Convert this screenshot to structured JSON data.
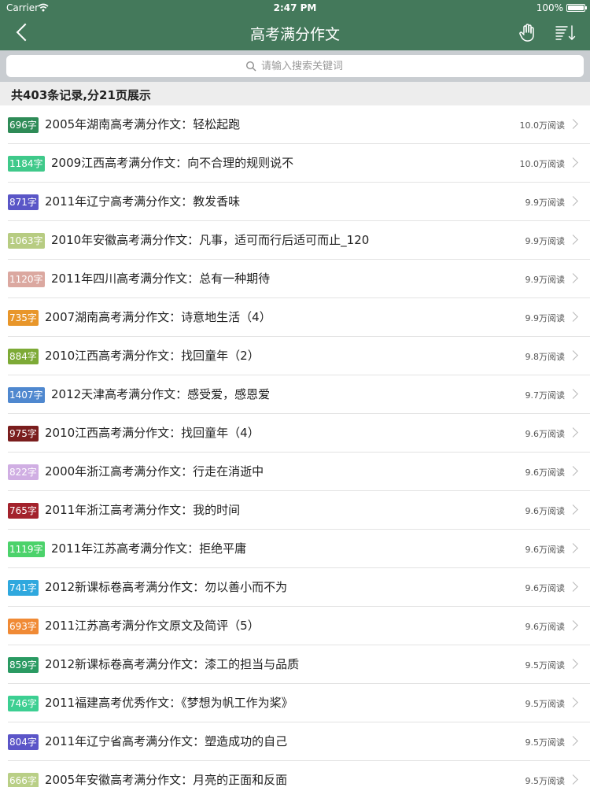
{
  "status": {
    "carrier": "Carrier",
    "time": "2:47 PM",
    "battery": "100%"
  },
  "nav": {
    "title": "高考满分作文"
  },
  "search": {
    "placeholder": "请输入搜索关键词"
  },
  "summary": "共403条记录,分21页展示",
  "items": [
    {
      "badge": "696字",
      "color": "#2e8b57",
      "title": "2005年湖南高考满分作文：轻松起跑",
      "reads": "10.0万阅读"
    },
    {
      "badge": "1184字",
      "color": "#3fc98a",
      "title": "2009江西高考满分作文：向不合理的规则说不",
      "reads": "10.0万阅读"
    },
    {
      "badge": "871字",
      "color": "#5a56c7",
      "title": "2011年辽宁高考满分作文：教发香味",
      "reads": "9.9万阅读"
    },
    {
      "badge": "1063字",
      "color": "#b7cc82",
      "title": "2010年安徽高考满分作文：凡事，适可而行后适可而止_120",
      "reads": "9.9万阅读"
    },
    {
      "badge": "1120字",
      "color": "#dba8a0",
      "title": "2011年四川高考满分作文：总有一种期待",
      "reads": "9.9万阅读"
    },
    {
      "badge": "735字",
      "color": "#e8962a",
      "title": "2007湖南高考满分作文：诗意地生活（4）",
      "reads": "9.9万阅读"
    },
    {
      "badge": "884字",
      "color": "#7daa36",
      "title": "2010江西高考满分作文：找回童年（2）",
      "reads": "9.8万阅读"
    },
    {
      "badge": "1407字",
      "color": "#4f88cf",
      "title": "2012天津高考满分作文：感受爱，感恩爱",
      "reads": "9.7万阅读"
    },
    {
      "badge": "975字",
      "color": "#7a1d1d",
      "title": "2010江西高考满分作文：找回童年（4）",
      "reads": "9.6万阅读"
    },
    {
      "badge": "822字",
      "color": "#d0aee3",
      "title": "2000年浙江高考满分作文：行走在消逝中",
      "reads": "9.6万阅读"
    },
    {
      "badge": "765字",
      "color": "#a3222c",
      "title": "2011年浙江高考满分作文：我的时间",
      "reads": "9.6万阅读"
    },
    {
      "badge": "1119字",
      "color": "#4cd26b",
      "title": "2011年江苏高考满分作文：拒绝平庸",
      "reads": "9.6万阅读"
    },
    {
      "badge": "741字",
      "color": "#2fa8de",
      "title": "2012新课标卷高考满分作文：勿以善小而不为",
      "reads": "9.6万阅读"
    },
    {
      "badge": "693字",
      "color": "#f08a35",
      "title": "2011江苏高考满分作文原文及简评（5）",
      "reads": "9.6万阅读"
    },
    {
      "badge": "859字",
      "color": "#2a9a62",
      "title": "2012新课标卷高考满分作文：漆工的担当与品质",
      "reads": "9.5万阅读"
    },
    {
      "badge": "746字",
      "color": "#3ccf92",
      "title": "2011福建高考优秀作文：《梦想为帆工作为桨》",
      "reads": "9.5万阅读"
    },
    {
      "badge": "804字",
      "color": "#5b55c8",
      "title": "2011年辽宁省高考满分作文：塑造成功的自己",
      "reads": "9.5万阅读"
    },
    {
      "badge": "666字",
      "color": "#b9cf86",
      "title": "2005年安徽高考满分作文：月亮的正面和反面",
      "reads": "9.5万阅读"
    }
  ]
}
